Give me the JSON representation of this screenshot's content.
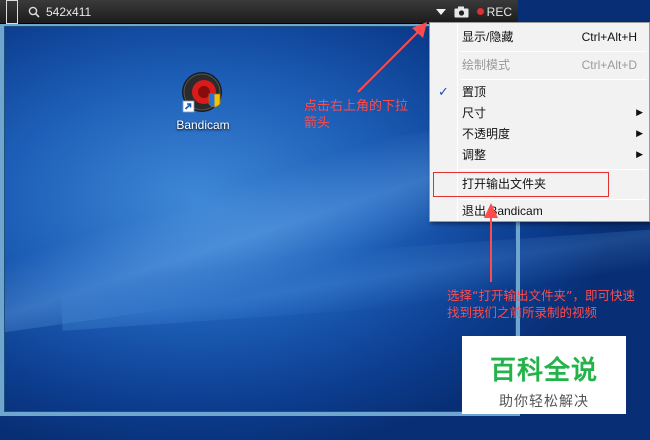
{
  "capture_bar": {
    "size_text": "542x411",
    "rec_label": "REC"
  },
  "desktop": {
    "icon_label": "Bandicam"
  },
  "menu": {
    "items": [
      {
        "label": "显示/隐藏",
        "shortcut": "Ctrl+Alt+H"
      },
      {
        "label": "绘制模式",
        "shortcut": "Ctrl+Alt+D"
      },
      {
        "label": "置顶",
        "checked": true
      },
      {
        "label": "尺寸",
        "submenu": true
      },
      {
        "label": "不透明度",
        "submenu": true
      },
      {
        "label": "调整",
        "submenu": true
      },
      {
        "label": "打开输出文件夹"
      },
      {
        "label": "退出 Bandicam"
      }
    ],
    "check_glyph": "✓",
    "arrow_glyph": "▶"
  },
  "annotations": {
    "note1": "点击右上角的下拉箭头",
    "note2": "选择“打开输出文件夹”，即可快速找到我们之前所录制的视频",
    "color": "#ff4b4b"
  },
  "watermark": {
    "title": "百科全说",
    "subtitle": "助你轻松解决"
  }
}
